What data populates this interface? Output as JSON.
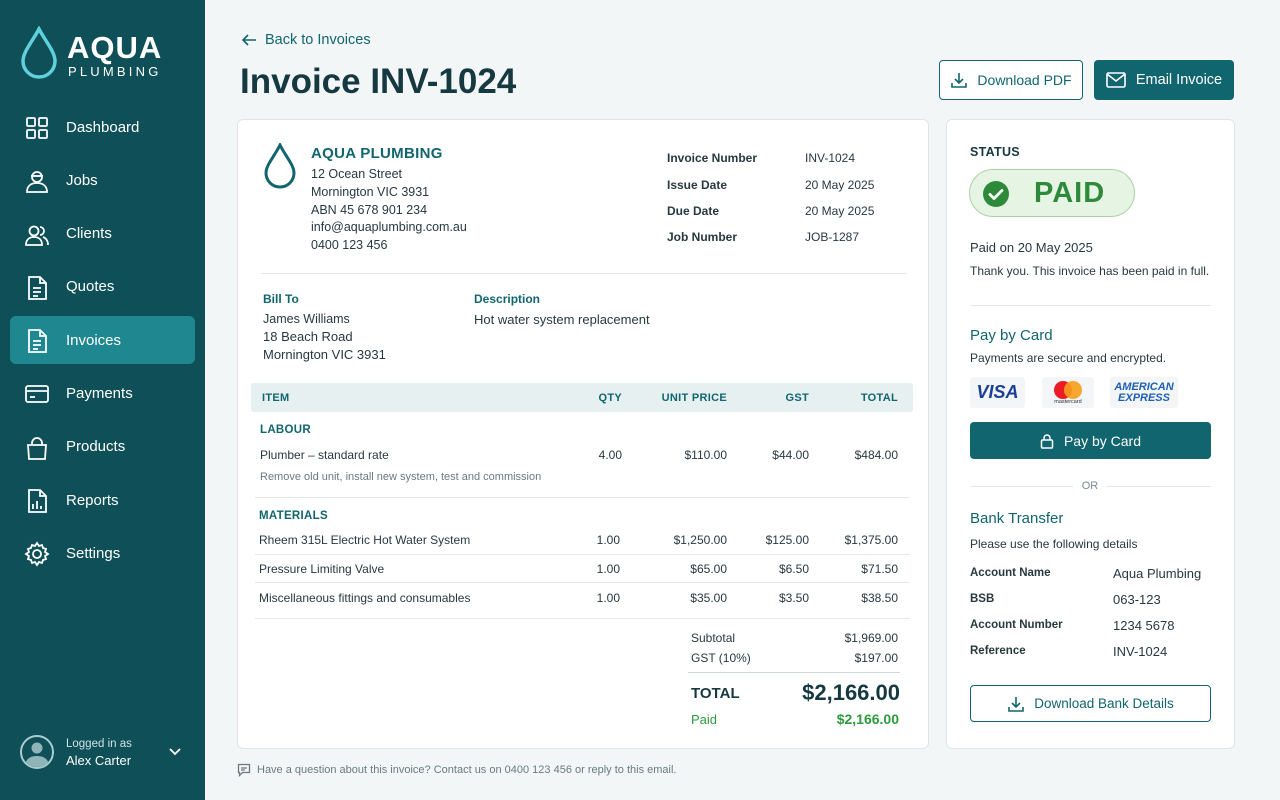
{
  "brand": {
    "name": "AQUA",
    "sub": "PLUMBING"
  },
  "nav": [
    {
      "label": "Dashboard",
      "icon": "grid-icon"
    },
    {
      "label": "Jobs",
      "icon": "worker-icon"
    },
    {
      "label": "Clients",
      "icon": "users-icon"
    },
    {
      "label": "Quotes",
      "icon": "document-icon"
    },
    {
      "label": "Invoices",
      "icon": "invoice-icon",
      "active": true
    },
    {
      "label": "Payments",
      "icon": "card-icon"
    },
    {
      "label": "Products",
      "icon": "bag-icon"
    },
    {
      "label": "Reports",
      "icon": "report-icon"
    },
    {
      "label": "Settings",
      "icon": "gear-icon"
    }
  ],
  "user": {
    "caption": "Logged in as",
    "name": "Alex Carter"
  },
  "header": {
    "back": "Back to Invoices",
    "title": "Invoice INV-1024",
    "download_pdf": "Download PDF",
    "email_invoice": "Email Invoice"
  },
  "company": {
    "name": "AQUA PLUMBING",
    "lines": [
      "12 Ocean Street",
      "Mornington VIC 3931",
      "ABN 45 678 901 234",
      "info@aquaplumbing.com.au",
      "0400 123 456"
    ]
  },
  "meta": [
    {
      "k": "Invoice Number",
      "v": "INV-1024"
    },
    {
      "k": "Issue Date",
      "v": "20 May 2025"
    },
    {
      "k": "Due Date",
      "v": "20 May 2025"
    },
    {
      "k": "Job Number",
      "v": "JOB-1287"
    }
  ],
  "bill_to": {
    "label": "Bill To",
    "name": "James Williams",
    "lines": [
      "18 Beach Road",
      "Mornington VIC 3931"
    ]
  },
  "description": {
    "label": "Description",
    "text": "Hot water system replacement"
  },
  "table": {
    "headers": {
      "item": "ITEM",
      "qty": "QTY",
      "unit": "UNIT PRICE",
      "gst": "GST",
      "total": "TOTAL"
    },
    "labour_label": "LABOUR",
    "labour": {
      "item": "Plumber – standard rate",
      "qty": "4.00",
      "unit": "$110.00",
      "gst": "$44.00",
      "total": "$484.00",
      "note": "Remove old unit, install new system, test and commission"
    },
    "materials_label": "MATERIALS",
    "materials": [
      {
        "item": "Rheem 315L Electric Hot Water System",
        "qty": "1.00",
        "unit": "$1,250.00",
        "gst": "$125.00",
        "total": "$1,375.00"
      },
      {
        "item": "Pressure Limiting Valve",
        "qty": "1.00",
        "unit": "$65.00",
        "gst": "$6.50",
        "total": "$71.50"
      },
      {
        "item": "Miscellaneous fittings and consumables",
        "qty": "1.00",
        "unit": "$35.00",
        "gst": "$3.50",
        "total": "$38.50"
      }
    ]
  },
  "totals": {
    "subtotal_label": "Subtotal",
    "subtotal": "$1,969.00",
    "gst_label": "GST (10%)",
    "gst": "$197.00",
    "total_label": "TOTAL",
    "total": "$2,166.00",
    "paid_label": "Paid",
    "paid": "$2,166.00"
  },
  "status": {
    "title": "STATUS",
    "badge": "PAID",
    "paid_on": "Paid on 20 May 2025",
    "thanks": "Thank you. This invoice has been paid in full."
  },
  "pay_card": {
    "heading": "Pay by Card",
    "secure": "Payments are secure and encrypted.",
    "visa": "VISA",
    "mastercard": "mastercard",
    "amex1": "AMERICAN",
    "amex2": "EXPRESS",
    "button": "Pay by Card",
    "or": "OR"
  },
  "bank": {
    "heading": "Bank Transfer",
    "intro": "Please use the following details",
    "rows": [
      {
        "k": "Account Name",
        "v": "Aqua Plumbing"
      },
      {
        "k": "BSB",
        "v": "063-123"
      },
      {
        "k": "Account Number",
        "v": "1234 5678"
      },
      {
        "k": "Reference",
        "v": "INV-1024"
      }
    ],
    "button": "Download Bank Details"
  },
  "footer": "Have a question about this invoice? Contact us on 0400 123 456 or reply to this email.",
  "colors": {
    "sidebar": "#0f4f57",
    "accent": "#11656e",
    "active": "#1f8790",
    "paid": "#2e8a3a",
    "drop": "#5fd0dc"
  }
}
